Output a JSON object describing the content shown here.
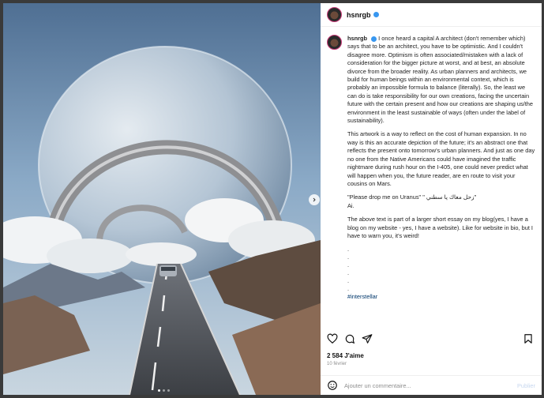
{
  "post": {
    "username": "hsnrgb",
    "caption_username": "hsnrgb",
    "paragraphs": [
      "I once heard a capital A architect (don't remember which) says that to be an architect, you have to be optimistic. And I couldn't disagree more. Optimism is often associated/mistaken with a lack of consideration for the bigger picture at worst, and at best, an absolute divorce from the broader reality. As urban planners and architects, we build for human beings within an environmental context, which is probably an impossible formula to balance (literally). So, the least we can do is take responsibility for our own creations, facing the uncertain future with the certain present and how our creations are shaping us/the environment in the least sustainable of ways (often under the label of sustainability).",
      "This artwork is a way to reflect on the cost of human expansion. In no way is this an accurate depiction of the future; it's an abstract one that reflects the present onto tomorrow's urban planners. And just as one day no one from the Native Americans could have imagined the traffic nightmare during rush hour on the I-405, one could never predict what will happen when you, the future reader, are en route to visit your cousins on Mars.",
      "\"Please drop me on Uranus\" \" زحل معاك يا سطني\"",
      "Ai.",
      "The above text is part of a larger short essay on my blog(yes, I have a blog on my website - yes, I have a website). Like for website in bio, but I have to warn you, it's weird!"
    ],
    "dots": [
      ".",
      ".",
      ".",
      ".",
      ".",
      "."
    ],
    "hashtag": "#interstellar",
    "likes": "2 584 J'aime",
    "date": "10 février",
    "comment_placeholder": "Ajouter un commentaire...",
    "publish_label": "Publier"
  },
  "colors": {
    "accent": "#3897f0",
    "hashtag": "#00376b",
    "ring": "#c93c7a"
  }
}
